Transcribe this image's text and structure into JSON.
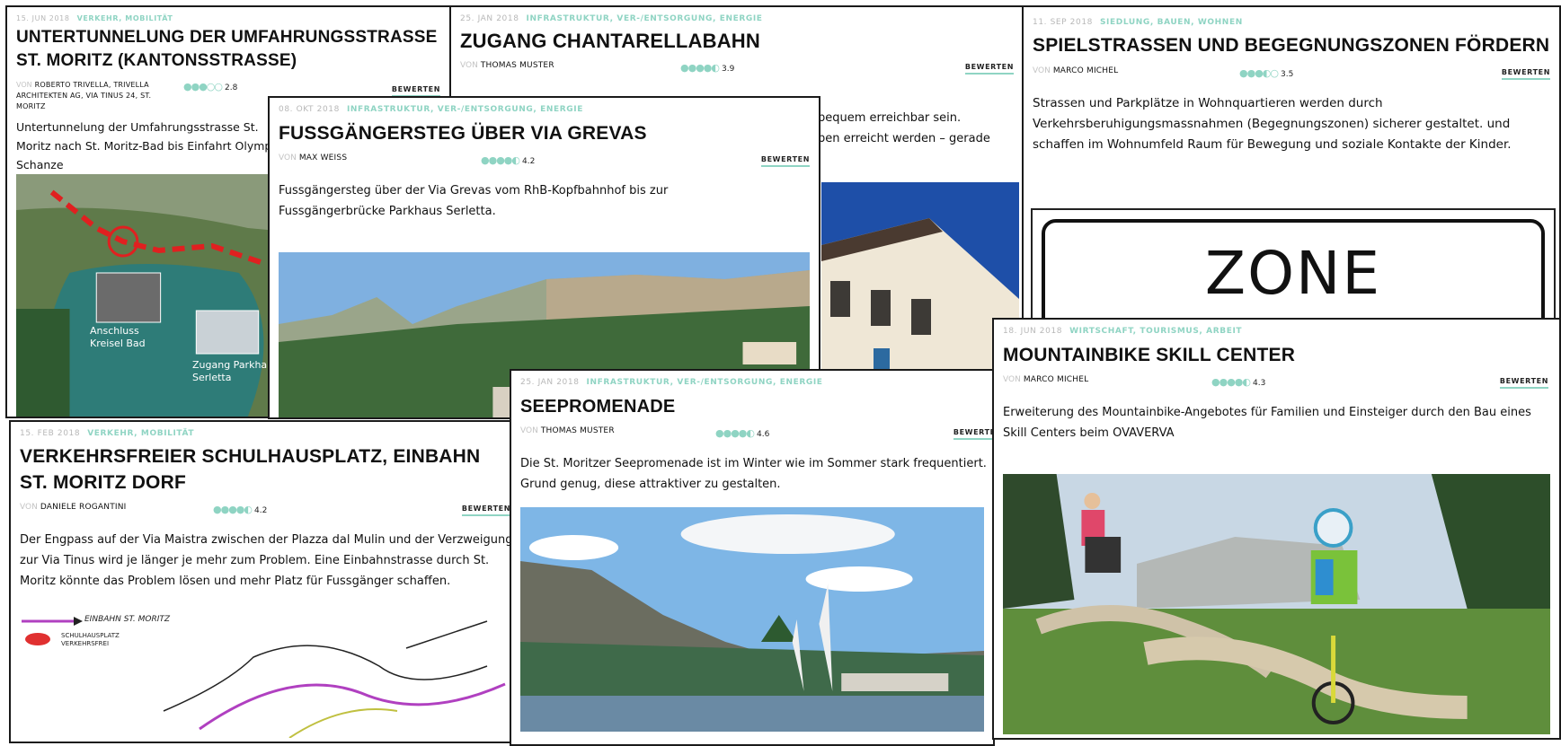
{
  "cards": [
    {
      "id": "umfahrung",
      "date": "15. JUN 2018",
      "category": "VERKEHR, MOBILITÄT",
      "title": "UNTERTUNNELUNG DER UMFAHRUNGSSTRASSE ST. MORITZ (KANTONSSTRASSE)",
      "von": "VON",
      "author": "ROBERTO TRIVELLA, TRIVELLA ARCHITEKTEN AG, VIA TINUS 24, ST. MORITZ",
      "rating": "2.8",
      "rate_label": "BEWERTEN",
      "desc": "Untertunnelung der Umfahrungsstrasse St. Moritz nach St. Moritz-Bad bis Einfahrt Olympia Schanze",
      "map_labels": [
        "Anschluss",
        "Kreisel Bad",
        "Zugang Parkhaus",
        "Serletta"
      ]
    },
    {
      "id": "chantarella",
      "date": "25. JAN 2018",
      "category": "INFRASTRUKTUR, VER-/ENTSORGUNG, ENERGIE",
      "title": "ZUGANG CHANTARELLABAHN",
      "von": "VON",
      "author": "THOMAS MUSTER",
      "rating": "3.9",
      "rate_label": "BEWERTEN",
      "desc_line1": "bequem erreichbar sein.",
      "desc_line2": "ben erreicht werden – gerade"
    },
    {
      "id": "spielstrassen",
      "date": "11. SEP 2018",
      "category": "SIEDLUNG, BAUEN, WOHNEN",
      "title": "SPIELSTRASSEN UND BEGEGNUNGSZONEN FÖRDERN",
      "von": "VON",
      "author": "MARCO MICHEL",
      "rating": "3.5",
      "rate_label": "BEWERTEN",
      "desc": "Strassen und Parkplätze in Wohnquartieren werden durch Verkehrsberuhigungsmassnahmen (Begegnungszonen) sicherer gestaltet. und schaffen im Wohnumfeld Raum für Bewegung und soziale Kontakte der Kinder.",
      "sign_text": "ZONE"
    },
    {
      "id": "fussgaengersteg",
      "date": "08. OKT 2018",
      "category": "INFRASTRUKTUR, VER-/ENTSORGUNG, ENERGIE",
      "title": "FUSSGÄNGERSTEG ÜBER VIA GREVAS",
      "von": "VON",
      "author": "MAX WEISS",
      "rating": "4.2",
      "rate_label": "BEWERTEN",
      "desc": "Fussgängersteg über der Via Grevas vom RhB-Kopfbahnhof bis zur Fussgängerbrücke Parkhaus Serletta."
    },
    {
      "id": "schulhausplatz",
      "date": "15. FEB 2018",
      "category": "VERKEHR, MOBILITÄT",
      "title": "VERKEHRSFREIER SCHULHAUSPLATZ, EINBAHN ST. MORITZ DORF",
      "von": "VON",
      "author": "DANIELE ROGANTINI",
      "rating": "4.2",
      "rate_label": "BEWERTEN",
      "desc": "Der Engpass auf der Via Maistra zwischen der Plazza dal Mulin und der Verzweigung zur Via Tinus wird je länger je mehr zum Problem. Eine Einbahnstrasse durch St. Moritz könnte das Problem lösen und mehr Platz für Fussgänger schaffen.",
      "legend1": "EINBAHN ST. MORITZ",
      "legend2a": "SCHULHAUSPLATZ",
      "legend2b": "VERKEHRSFREI"
    },
    {
      "id": "seepromenade",
      "date": "25. JAN 2018",
      "category": "INFRASTRUKTUR, VER-/ENTSORGUNG, ENERGIE",
      "title": "SEEPROMENADE",
      "von": "VON",
      "author": "THOMAS MUSTER",
      "rating": "4.6",
      "rate_label": "BEWERTEN",
      "desc": "Die St. Moritzer Seepromenade ist im Winter wie im Sommer stark frequentiert. Grund genug, diese attraktiver zu gestalten."
    },
    {
      "id": "mountainbike",
      "date": "18. JUN 2018",
      "category": "WIRTSCHAFT, TOURISMUS, ARBEIT",
      "title": "MOUNTAINBIKE SKILL CENTER",
      "von": "VON",
      "author": "MARCO MICHEL",
      "rating": "4.3",
      "rate_label": "BEWERTEN",
      "desc": "Erweiterung des Mountainbike-Angebotes für Familien und Einsteiger durch den Bau eines Skill Centers beim OVAVERVA"
    }
  ]
}
